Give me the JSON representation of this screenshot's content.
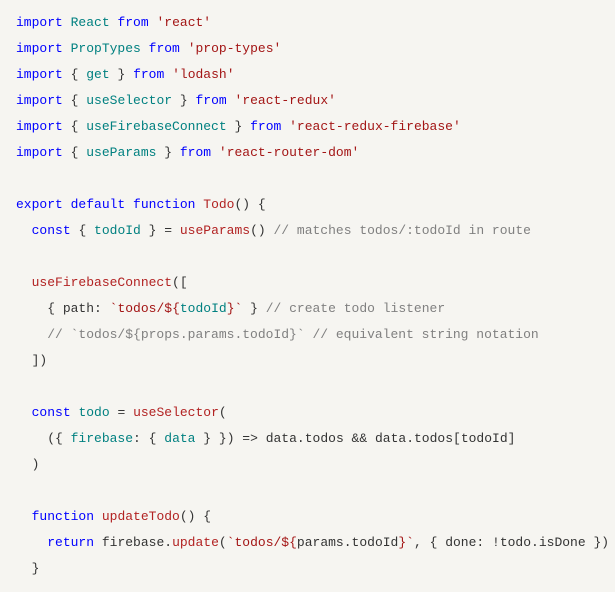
{
  "code": {
    "l1": {
      "import": "import",
      "ident": "React",
      "from": "from",
      "str": "'react'"
    },
    "l2": {
      "import": "import",
      "ident": "PropTypes",
      "from": "from",
      "str": "'prop-types'"
    },
    "l3": {
      "import": "import",
      "ident": "get",
      "from": "from",
      "str": "'lodash'"
    },
    "l4": {
      "import": "import",
      "ident": "useSelector",
      "from": "from",
      "str": "'react-redux'"
    },
    "l5": {
      "import": "import",
      "ident": "useFirebaseConnect",
      "from": "from",
      "str": "'react-redux-firebase'"
    },
    "l6": {
      "import": "import",
      "ident": "useParams",
      "from": "from",
      "str": "'react-router-dom'"
    },
    "l8": {
      "export": "export",
      "default": "default",
      "function": "function",
      "name": "Todo"
    },
    "l9": {
      "const": "const",
      "ident": "todoId",
      "call": "useParams",
      "comment": "// matches todos/:todoId in route"
    },
    "l11": {
      "call": "useFirebaseConnect"
    },
    "l12": {
      "path": "path",
      "str1": "`todos/${",
      "ident": "todoId",
      "str2": "}`",
      "comment": "// create todo listener"
    },
    "l13": {
      "comment": "// `todos/${props.params.todoId}` // equivalent string notation"
    },
    "l14": {
      "close": "])"
    },
    "l16": {
      "const": "const",
      "ident": "todo",
      "call": "useSelector"
    },
    "l17": {
      "fb": "firebase",
      "data": "data",
      "todos": "todos",
      "todoId": "todoId"
    },
    "l18": {
      "close": ")"
    },
    "l20": {
      "function": "function",
      "name": "updateTodo"
    },
    "l21": {
      "return": "return",
      "fb": "firebase",
      "update": "update",
      "str1": "`todos/${",
      "params": "params",
      "todoId": "todoId",
      "str2": "}`",
      "done": "done",
      "todo": "todo",
      "isDone": "isDone"
    },
    "l22": {
      "close": "}"
    }
  }
}
